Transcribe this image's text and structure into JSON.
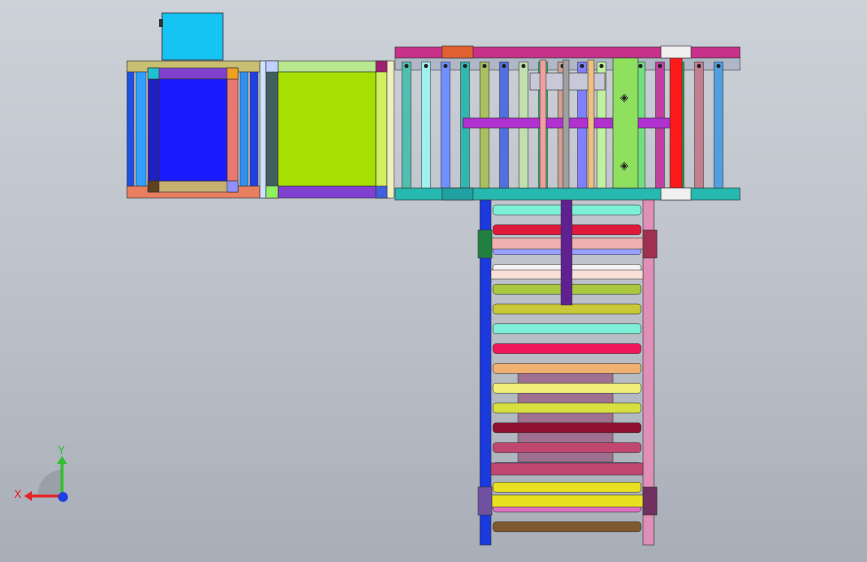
{
  "app": {
    "viewport_background_top": "#cdd1d8",
    "viewport_background_bottom": "#a8aeb8"
  },
  "triad": {
    "x_label": "X",
    "y_label": "Y",
    "x_color": "#e0262a",
    "y_color": "#2fbf2f",
    "z_color": "#1f3fe0",
    "icon": "coordinate-triad-icon"
  },
  "model": {
    "motor_color": "#16c4f4",
    "left_module_panel_color": "#1a1aff",
    "middle_module_panel_color": "#a6e000",
    "top_rail_color": "#c8308a",
    "bottom_rail_color": "#27b8b0",
    "crossbar_color": "#b030d0",
    "red_post_color": "#ff1a1a",
    "vertical_conveyor_left_rail": "#1a3ae0",
    "vertical_conveyor_right_rail": "#e090b8",
    "vertical_roller_colors": [
      "#7ff0d8",
      "#e0183a",
      "#9aa0ff",
      "#f4f4f4",
      "#a8c840",
      "#c8c838",
      "#7ff0d8",
      "#f01858",
      "#f0b070",
      "#f0f078",
      "#d8e040",
      "#901030",
      "#c04870",
      "#90b0ff",
      "#e8e020",
      "#e070c0",
      "#805830"
    ],
    "horizontal_roller_colors": [
      "#4fc0b0",
      "#a0f0f0",
      "#7090ff",
      "#30b8b0",
      "#a8c060",
      "#5070e0",
      "#c0e0b0",
      "#30c070",
      "#d0a090",
      "#8080ff",
      "#c0f0a0",
      "#a0a040",
      "#70e080",
      "#c040a0",
      "#3a9a40",
      "#c08090",
      "#50a0e0"
    ]
  }
}
